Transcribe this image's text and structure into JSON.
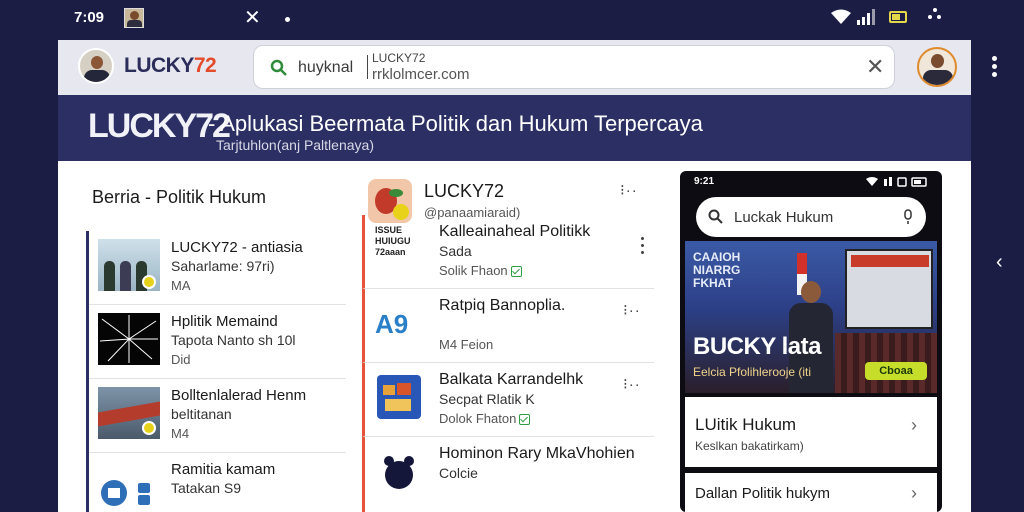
{
  "status_bar": {
    "time": "7:09",
    "tab_close": "✕",
    "wifi_icon": "wifi-icon",
    "signal_icon": "signal-icon",
    "battery_icon": "battery-icon"
  },
  "toolbar": {
    "brand_prefix": "LUCKY",
    "brand_suffix": "72",
    "search_query": "huyknal",
    "address_line1": "LUCKY72",
    "address_line2": "rrklolmcer.com",
    "clear_label": "✕"
  },
  "banner": {
    "logo": "LUCKY72",
    "title": "- Aplukasi Beermata Politik dan Hukum Terpercaya",
    "subtitle": "Tarjtuhlon(anj Paltlenaya)"
  },
  "left": {
    "section_title": "Berria - Politik Hukum",
    "items": [
      {
        "t1": "LUCKY72 - antiasia",
        "t2": "Saharlame: 97ri)",
        "t3": "MA"
      },
      {
        "t1": "Hplitik Memaind",
        "t2": "Tapota Nanto sh 10l",
        "t3": "Did"
      },
      {
        "t1": "Bolltenlalerad Henm",
        "t2": "beltitanan",
        "t3": "M4"
      },
      {
        "t1": "Ramitia kamam",
        "t2": "Tatakan S9",
        "t3": ""
      }
    ]
  },
  "middle": {
    "header": {
      "title": "LUCKY72",
      "handle": "@panaamiaraid)"
    },
    "items": [
      {
        "icon_text": "ISSUE HUIUGU 72aaan",
        "t1": "Kalleainaheal Politikk",
        "t2": "Sada",
        "t3": "Solik Fhaon"
      },
      {
        "icon_text": "A9",
        "t1": "Ratpiq Bannoplia.",
        "t2": "",
        "t3": "M4 Feion"
      },
      {
        "icon_text": "",
        "t1": "Balkata Karrandelhk",
        "t2": "Secpat Rlatik K",
        "t3": "Dolok Fhaton"
      },
      {
        "icon_text": "",
        "t1": "Hominon Rary MkaVhohien",
        "t2": "Colcie",
        "t3": ""
      }
    ]
  },
  "phone": {
    "time": "9:21",
    "search_query": "Luckak Hukum",
    "hero_sign": "CAAIOH NIARRG FKHAT",
    "hero_title": "BUCKY lata",
    "hero_subtitle": "Eelcia Pfolihlerooje (iti",
    "hero_button": "Cboaa",
    "cards": [
      {
        "t1": "LUitik Hukum",
        "t2": "Keslkan bakatirkam)"
      },
      {
        "t1": "Dallan Politik hukym",
        "t2": ""
      }
    ]
  },
  "colors": {
    "background": "#1b1d45",
    "banner": "#2c2f63",
    "accent_red": "#e5533a",
    "accent_green": "#c6dd2a"
  }
}
